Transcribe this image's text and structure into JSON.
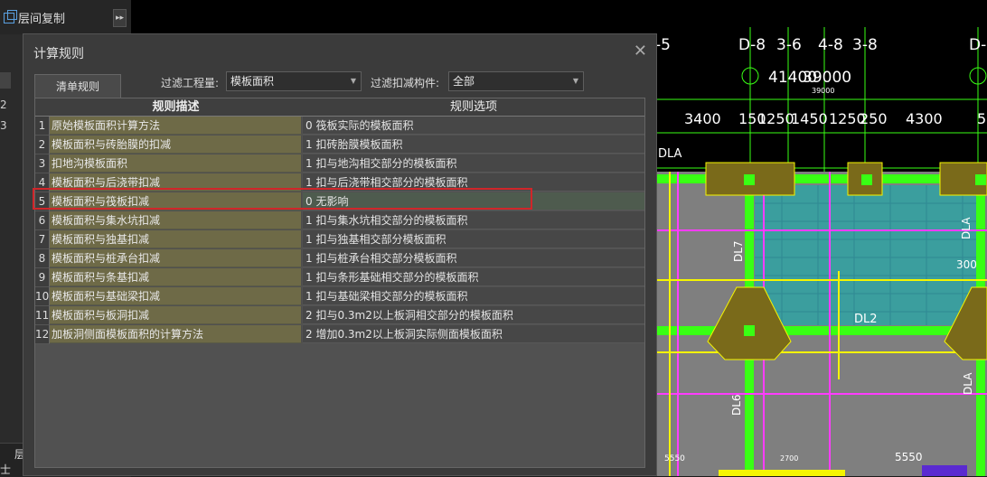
{
  "app": {
    "copy_label": "层间复制",
    "collapse_glyph": "▸▸",
    "left_numbers": [
      "2",
      "3"
    ],
    "bottom_labels": [
      "层",
      "士"
    ]
  },
  "cad": {
    "top_labels": [
      "-5",
      "D-8",
      "3-6",
      "4-8",
      "3-8",
      "D-",
      "41400",
      "39000",
      "39000",
      "3400",
      "150",
      "1250",
      "1450",
      "1250",
      "250",
      "4300",
      "5",
      "DLA",
      "DL7",
      "DL2",
      "DL6",
      "DLA",
      "DLA",
      "300",
      "5550",
      "5550",
      "2700"
    ]
  },
  "dialog": {
    "title": "计算规则",
    "close_glyph": "✕",
    "tab_label": "清单规则",
    "filter_project_label": "过滤工程量:",
    "filter_project_value": "模板面积",
    "filter_member_label": "过滤扣减构件:",
    "filter_member_value": "全部",
    "header_desc": "规则描述",
    "header_option": "规则选项",
    "rows": [
      {
        "num": "1",
        "desc": "原始模板面积计算方法",
        "option": "0  筏板实际的模板面积"
      },
      {
        "num": "2",
        "desc": "模板面积与砖胎膜的扣减",
        "option": "1 扣砖胎膜模板面积"
      },
      {
        "num": "3",
        "desc": "扣地沟模板面积",
        "option": "1 扣与地沟相交部分的模板面积"
      },
      {
        "num": "4",
        "desc": "模板面积与后浇带扣减",
        "option": "1 扣与后浇带相交部分的模板面积"
      },
      {
        "num": "5",
        "desc": "模板面积与筏板扣减",
        "option": "0  无影响"
      },
      {
        "num": "6",
        "desc": "模板面积与集水坑扣减",
        "option": "1 扣与集水坑相交部分的模板面积"
      },
      {
        "num": "7",
        "desc": "模板面积与独基扣减",
        "option": "1  扣与独基相交部分模板面积"
      },
      {
        "num": "8",
        "desc": "模板面积与桩承台扣减",
        "option": "1  扣与桩承台相交部分模板面积"
      },
      {
        "num": "9",
        "desc": "模板面积与条基扣减",
        "option": "1 扣与条形基础相交部分的模板面积"
      },
      {
        "num": "10",
        "desc": "模板面积与基础梁扣减",
        "option": "1 扣与基础梁相交部分的模板面积"
      },
      {
        "num": "11",
        "desc": "模板面积与板洞扣减",
        "option": "2 扣与0.3m2以上板洞相交部分的模板面积"
      },
      {
        "num": "12",
        "desc": "加板洞侧面模板面积的计算方法",
        "option": "2 增加0.3m2以上板洞实际侧面模板面积"
      }
    ]
  }
}
